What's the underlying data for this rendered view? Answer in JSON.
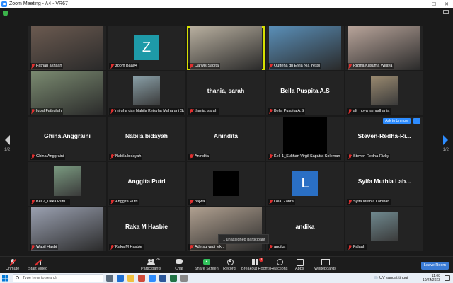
{
  "window": {
    "title": "Zoom Meeting - A4 - VR67",
    "minimize": "—",
    "maximize": "☐",
    "close": "✕"
  },
  "pagination": {
    "left": "1/2",
    "right": "1/2"
  },
  "colors": {
    "accent": "#2d8cff",
    "active_speaker": "#d6e000",
    "muted": "#e03030",
    "share_green": "#31c35c"
  },
  "tiles": [
    {
      "label": "Fathan akhsan",
      "video": "photo",
      "tone": "#6b5a50"
    },
    {
      "label": "zoom Baa04",
      "video": "avatar",
      "letter": "Z",
      "avatar_color": "#1e9aa8"
    },
    {
      "label": "Darwis Sagita",
      "video": "photo",
      "tone": "#b9b0a0",
      "active": true
    },
    {
      "label": "Quttena dn Elvia Nia Yessi",
      "video": "photo",
      "tone": "#5a8fb8"
    },
    {
      "label": "Rizma Kusuma Wijaya",
      "video": "photo",
      "tone": "#b8a49a"
    },
    {
      "label": "Iqbal Fathullah",
      "video": "photo",
      "tone": "#7a8a70"
    },
    {
      "label": "mirgha dan Nabila Keisyha Maharani Soes...",
      "video": "photo_small",
      "tone": "#8aa0a8"
    },
    {
      "name": "thania, sarah",
      "label": "thania, sarah"
    },
    {
      "name": "Bella Puspita A.S",
      "label": "Bella Puspita A.S"
    },
    {
      "label": "alt_nova ramadhania",
      "video": "photo_small",
      "tone": "#9a8a70"
    },
    {
      "name": "Ghina Anggraini",
      "label": "Ghina Anggraini"
    },
    {
      "name": "Nabila bidayah",
      "label": "Nabila bidayah"
    },
    {
      "name": "Anindita",
      "label": "Anindita"
    },
    {
      "label": "Kel. 1_Sulthan Virgil Saputra Soleman",
      "video": "black"
    },
    {
      "name": "Steven-Redha-Ri...",
      "label": "Steven-Redha-Rizky",
      "unmute": "Ask to Unmute",
      "more": "···"
    },
    {
      "label": "Kel.2_Deka Putri L",
      "video": "photo_small",
      "tone": "#7a9a80"
    },
    {
      "name": "Anggita Putri",
      "label": "Anggita Putri"
    },
    {
      "label": "najwa",
      "video": "black_small"
    },
    {
      "label": "Lola, Zahra",
      "video": "avatar",
      "letter": "L",
      "avatar_color": "#2a6fc4"
    },
    {
      "name": "Syifa Muthia Lab...",
      "label": "Syifa Muthia Labibah"
    },
    {
      "label": "Wabil Hasbi",
      "video": "photo",
      "tone": "#9aa0b0"
    },
    {
      "name": "Raka M Hasbie",
      "label": "Raka M Hasbie"
    },
    {
      "label": "Ade suryadi_ek...",
      "video": "photo",
      "tone": "#b0a090"
    },
    {
      "name": "andika",
      "label": "andika"
    },
    {
      "label": "Falaah",
      "video": "photo_small",
      "tone": "#708a90"
    }
  ],
  "tooltip": "1 unassigned participant",
  "toolbar": {
    "unmute": "Unmute",
    "start_video": "Start Video",
    "participants": "Participants",
    "participants_count": "26",
    "chat": "Chat",
    "share_screen": "Share Screen",
    "record": "Record",
    "breakout_rooms": "Breakout Rooms",
    "breakout_badge": "1",
    "reactions": "Reactions",
    "apps": "Apps",
    "whiteboards": "Whiteboards",
    "leave": "Leave Room"
  },
  "taskbar": {
    "search_placeholder": "Type here to search",
    "weather": "UV sangat tinggi",
    "time": "11:08",
    "date": "10/24/2022"
  }
}
